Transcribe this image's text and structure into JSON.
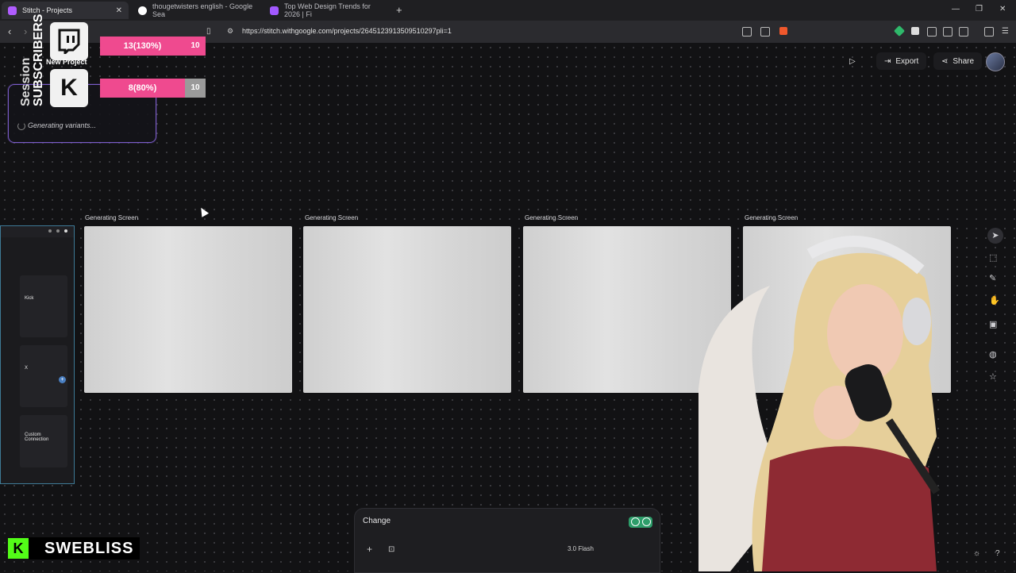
{
  "browser": {
    "tabs": [
      {
        "title": "Stitch - Projects",
        "color": "#b05cff"
      },
      {
        "title": "thougetwisters english - Google Sea",
        "color": "#4285f4"
      },
      {
        "title": "Top Web Design Trends for 2026 | Fi",
        "color": "#a259ff"
      }
    ],
    "new_tab": "+",
    "url": "https://stitch.withgoogle.com/projects/2645123913509510297pli=1",
    "window": {
      "minimize": "—",
      "maximize": "❐",
      "close": "✕"
    }
  },
  "app": {
    "export_label": "Export",
    "share_label": "Share",
    "status_text": "Generating variants...",
    "generating_label": "Generating Screen",
    "screens_count": 4,
    "existing_screen": {
      "kick_title": "Kick",
      "x_title": "X",
      "custom_title": "Custom Connection"
    },
    "prompt": {
      "text": "Change",
      "model": "3.0 Flash"
    },
    "accent": "#7b5cc9"
  },
  "overlay": {
    "session_label": "Session",
    "subscribers_label": "SUBSCRIBERS",
    "new_project_label": "New Project",
    "twitch": {
      "value": "13(130%)",
      "goal": "10",
      "progress": 1.0
    },
    "kick": {
      "value": "8(80%)",
      "goal": "10",
      "progress": 0.8
    },
    "streamer_name": "SWEBLISS",
    "kick_color": "#53fc18",
    "bar_color": "#ef4a8f"
  }
}
